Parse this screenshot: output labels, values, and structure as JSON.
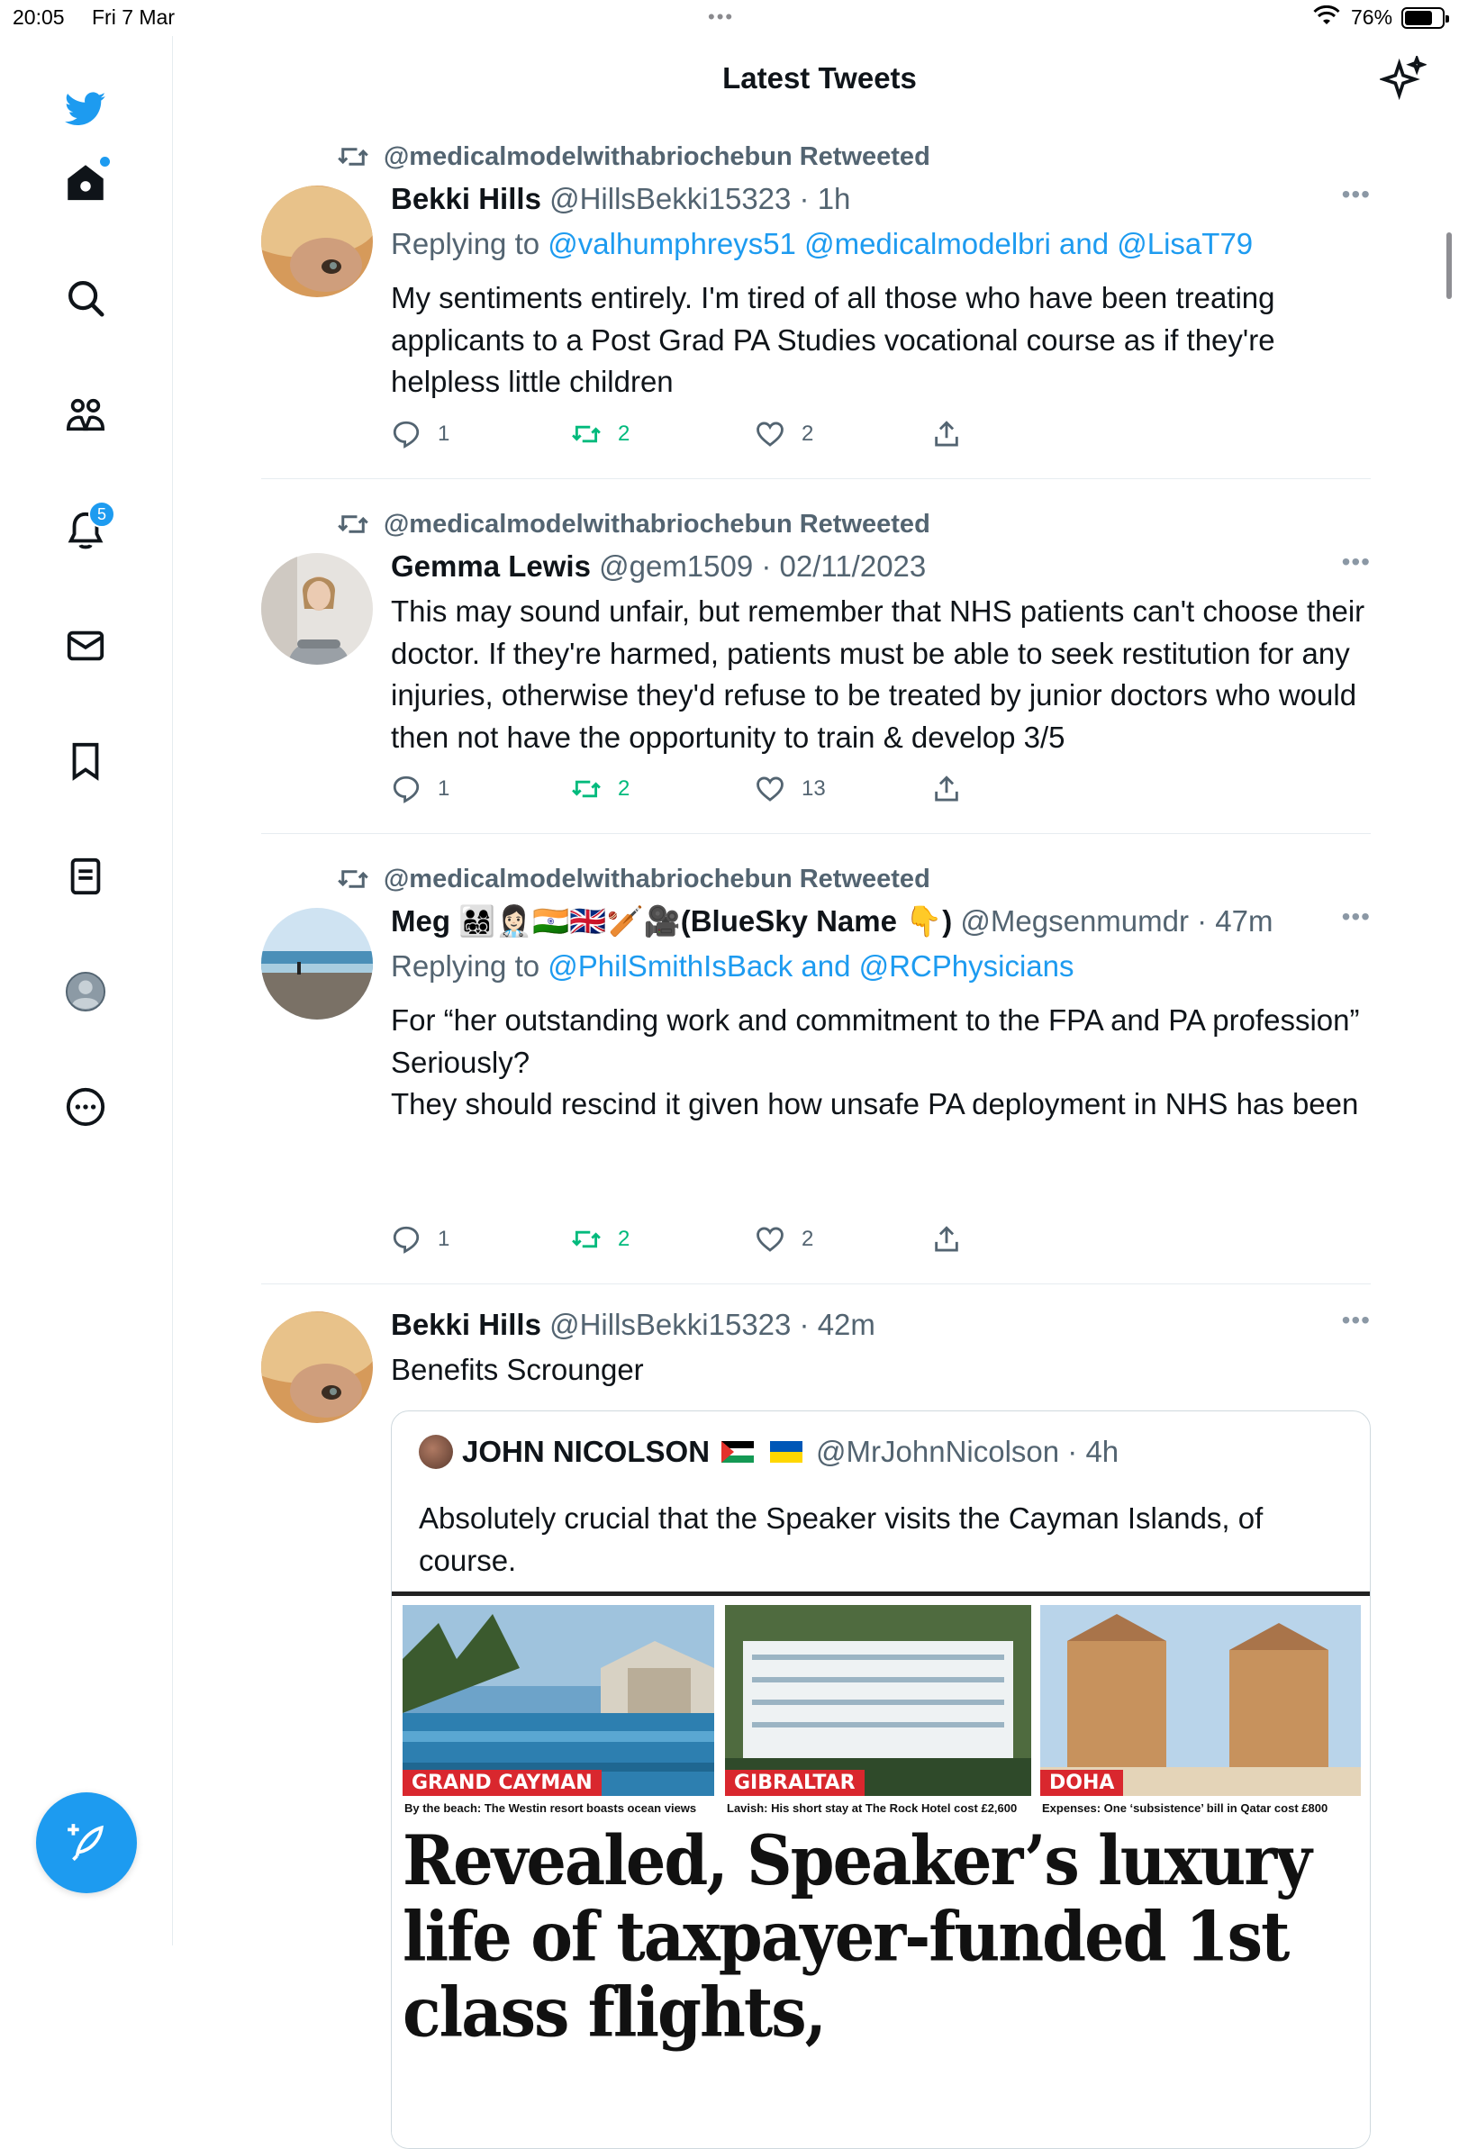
{
  "status_bar": {
    "time": "20:05",
    "date": "Fri 7 Mar",
    "battery_pct": "76%",
    "battery_level": 0.76
  },
  "header": {
    "title": "Latest Tweets"
  },
  "sidebar": {
    "items": [
      {
        "icon": "twitter-bird-icon"
      },
      {
        "icon": "home-icon"
      },
      {
        "icon": "search-icon"
      },
      {
        "icon": "communities-icon"
      },
      {
        "icon": "notifications-icon",
        "badge": "5"
      },
      {
        "icon": "messages-icon"
      },
      {
        "icon": "bookmarks-icon"
      },
      {
        "icon": "lists-icon"
      },
      {
        "icon": "profile-icon"
      },
      {
        "icon": "more-icon"
      }
    ],
    "compose_icon": "compose-feather-icon"
  },
  "tweets": [
    {
      "retweeted_by": "@medicalmodelwithabriochebun Retweeted",
      "name": "Bekki Hills",
      "handle_time": "@HillsBekki15323 · 1h",
      "replying_prefix": "Replying to",
      "replying_mentions": "@valhumphreys51 @medicalmodelbri and @LisaT79",
      "text": "My sentiments entirely. I'm tired of all those who have been treating applicants to a Post Grad PA Studies vocational course as if they're helpless little children",
      "replies": "1",
      "retweets": "2",
      "likes": "2"
    },
    {
      "retweeted_by": "@medicalmodelwithabriochebun Retweeted",
      "name": "Gemma Lewis",
      "handle_time": "@gem1509 · 02/11/2023",
      "text": "This may sound unfair, but remember that NHS patients can't choose their doctor. If they're harmed, patients must be able to seek restitution for any injuries, otherwise they'd refuse to be treated by junior doctors who would then not have the opportunity to train & develop 3/5",
      "replies": "1",
      "retweets": "2",
      "likes": "13"
    },
    {
      "retweeted_by": "@medicalmodelwithabriochebun Retweeted",
      "name": "Meg 👨‍👩‍👧‍👦👩🏻‍⚕️🇮🇳🇬🇧🏏🎥(BlueSky Name 👇)",
      "handle_time": "@Megsenmumdr · 47m",
      "replying_prefix": "Replying to",
      "replying_mentions": "@PhilSmithIsBack and @RCPhysicians",
      "text_lines": [
        "For “her outstanding work and commitment to the FPA and PA profession”",
        "Seriously?",
        "They should rescind it given how unsafe PA deployment in NHS has been"
      ],
      "replies": "1",
      "retweets": "2",
      "likes": "2"
    },
    {
      "name": "Bekki Hills",
      "handle_time": "@HillsBekki15323 · 42m",
      "text": "Benefits Scrounger",
      "quote": {
        "name": "JOHN NICOLSON",
        "handle_time": "@MrJohnNicolson · 4h",
        "text": "Absolutely crucial that the Speaker visits the Cayman Islands, of course.",
        "image": {
          "labels": [
            "GRAND CAYMAN",
            "GIBRALTAR",
            "DOHA"
          ],
          "captions": [
            "By the beach: The Westin resort boasts ocean views",
            "Lavish: His short stay at The Rock Hotel cost £2,600",
            "Expenses: One ‘subsistence’ bill in Qatar cost £800"
          ],
          "headline": "Revealed, Speaker’s luxury life of taxpayer-funded 1st class flights,"
        }
      }
    }
  ],
  "colors": {
    "accent": "#1d9bf0",
    "retweet_green": "#00ba7c",
    "secondary_text": "#536471",
    "label_red": "#d9272e"
  }
}
